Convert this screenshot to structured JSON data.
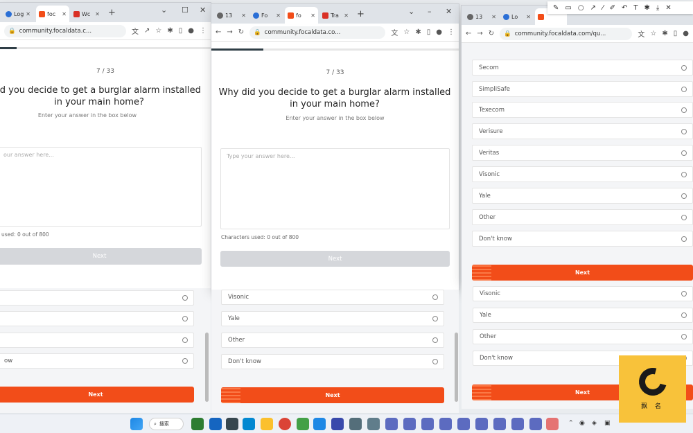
{
  "left_window": {
    "tabs": [
      {
        "label": "Log"
      },
      {
        "label": "foc"
      },
      {
        "label": "Wc"
      }
    ],
    "address": "community.focaldata.c...",
    "counter": "7 / 33",
    "question": "id you decide to get a burglar alarm installed in your main home?",
    "hint": "Enter your answer in the box below",
    "placeholder": "our answer here...",
    "chars_used": "used: 0 out of 800",
    "next_label": "Next",
    "behind_options": [
      "",
      "",
      "",
      "ow"
    ],
    "behind_next": "Next"
  },
  "middle_window": {
    "tabs": [
      {
        "label": "13"
      },
      {
        "label": "Fo"
      },
      {
        "label": "fo"
      },
      {
        "label": "Tra"
      }
    ],
    "address": "community.focaldata.co...",
    "counter": "7 / 33",
    "question": "Why did you decide to get a burglar alarm installed in your main home?",
    "hint": "Enter your answer in the box below",
    "placeholder": "Type your answer here...",
    "chars_used": "Characters used: 0 out of 800",
    "next_label": "Next",
    "behind_options": [
      "Visonic",
      "Yale",
      "Other",
      "Don't know"
    ],
    "behind_next": "Next"
  },
  "right_window": {
    "tabs": [
      {
        "label": "13"
      },
      {
        "label": "Lo"
      },
      {
        "label": ""
      }
    ],
    "address": "community.focaldata.com/qu...",
    "options": [
      "Secom",
      "SimpliSafe",
      "Texecom",
      "Verisure",
      "Veritas",
      "Visonic",
      "Yale",
      "Other",
      "Don't know"
    ],
    "next_label": "Next",
    "behind_options": [
      "Visonic",
      "Yale",
      "Other",
      "Don't know"
    ],
    "behind_next": "Next"
  },
  "taskbar": {
    "search_label": "搜索"
  },
  "logo_text": "飘 名",
  "colors": {
    "accent": "#f24d19",
    "progress": "#2f3e46",
    "disabled": "#d5d7db",
    "logo_bg": "#f8c23a"
  }
}
